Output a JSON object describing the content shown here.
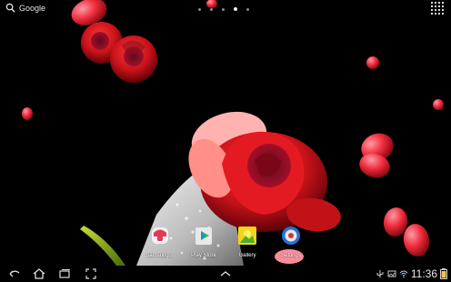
{
  "search": {
    "label": "Google",
    "icon": "search-icon"
  },
  "pager": {
    "pages": 5,
    "active_index": 3
  },
  "app_drawer": {
    "icon": "app-grid-icon"
  },
  "shortcuts": [
    {
      "label": "Samsung…",
      "icon": "samsung-apps-icon"
    },
    {
      "label": "Play Store",
      "icon": "play-store-icon"
    },
    {
      "label": "Gallery",
      "icon": "gallery-icon"
    },
    {
      "label": "Settings",
      "icon": "settings-icon"
    }
  ],
  "navbar": {
    "back_icon": "back-icon",
    "home_icon": "home-icon",
    "recent_icon": "recent-apps-icon",
    "screenshot_icon": "screenshot-icon",
    "up_icon": "chevron-up-icon"
  },
  "status": {
    "time": "11:36",
    "wifi": "wifi-icon",
    "usb": "usb-icon",
    "battery": "battery-icon"
  },
  "colors": {
    "accent": "#ff3a3a",
    "rose": "#d3201f",
    "petal": "#ff5a6c"
  }
}
